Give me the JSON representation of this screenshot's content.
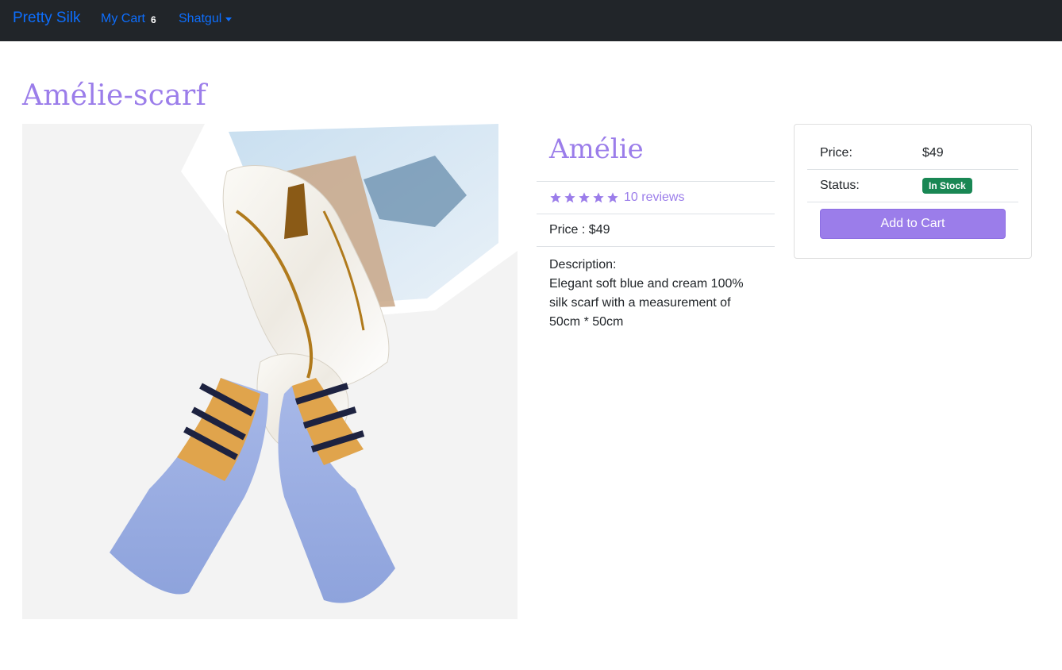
{
  "navbar": {
    "brand": "Pretty Silk",
    "cart_label": "My Cart",
    "cart_count": "6",
    "user_label": "Shatgul"
  },
  "page": {
    "title": "Amélie-scarf"
  },
  "product": {
    "name": "Amélie",
    "rating": 5,
    "reviews": "10 reviews",
    "price_line": "Price : $49",
    "description_label": "Description:",
    "description": "Elegant soft blue and cream 100% silk scarf with a measurement of 50cm * 50cm"
  },
  "purchase_card": {
    "price_label": "Price:",
    "price_value": "$49",
    "status_label": "Status:",
    "status_value": "In Stock",
    "add_button": "Add to Cart"
  },
  "colors": {
    "accent": "#9b7dea",
    "nav_bg": "#212529",
    "link": "#0d6efd",
    "stock": "#198754"
  },
  "icons": [
    "star-icon",
    "caret-down-icon"
  ]
}
